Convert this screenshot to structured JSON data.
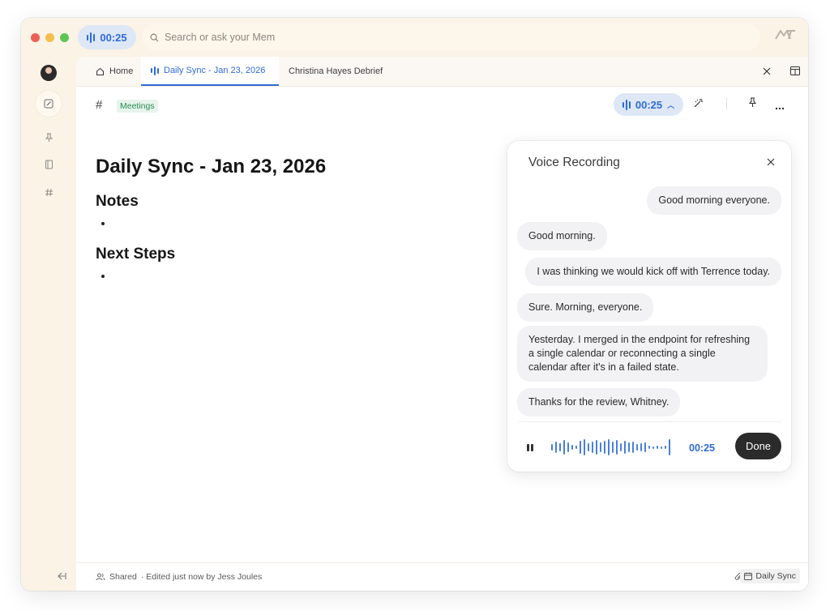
{
  "topbar": {
    "recording_time": "00:25",
    "search_placeholder": "Search or ask your Mem"
  },
  "tabs": {
    "home": "Home",
    "active": "Daily Sync - Jan 23, 2026",
    "third": "Christina Hayes Debrief"
  },
  "toolbar": {
    "tag": "Meetings",
    "recording_time": "00:25"
  },
  "doc": {
    "title": "Daily Sync - Jan 23, 2026",
    "section1": "Notes",
    "section2": "Next Steps"
  },
  "voice": {
    "title": "Voice Recording",
    "messages": [
      {
        "side": "right",
        "text": "Good morning everyone."
      },
      {
        "side": "left",
        "text": "Good morning."
      },
      {
        "side": "right",
        "text": "I was thinking we would kick off with Terrence today."
      },
      {
        "side": "left",
        "text": "Sure. Morning, everyone."
      },
      {
        "side": "left",
        "text": "Yesterday. I merged in the endpoint for refreshing a single calendar or reconnecting a single calendar after it's in a failed state."
      },
      {
        "side": "left",
        "text": "Thanks for the review, Whitney."
      }
    ],
    "time": "00:25",
    "done_label": "Done"
  },
  "footer": {
    "shared": "Shared",
    "edited": "· Edited just now by Jess Joules",
    "chip": "Daily Sync"
  },
  "colors": {
    "accent": "#2f6bd6",
    "window_bg": "#fbf3e6",
    "tag_text": "#2b8a57",
    "tag_bg": "#e6f4ec"
  },
  "icons": [
    "search-icon",
    "home-icon",
    "pencil-icon",
    "pin-icon",
    "book-icon",
    "hash-icon",
    "close-icon",
    "layout-icon",
    "magic-icon",
    "more-icon",
    "pause-icon",
    "paperclip-icon",
    "calendar-icon",
    "users-icon",
    "collapse-icon",
    "logo-icon"
  ]
}
